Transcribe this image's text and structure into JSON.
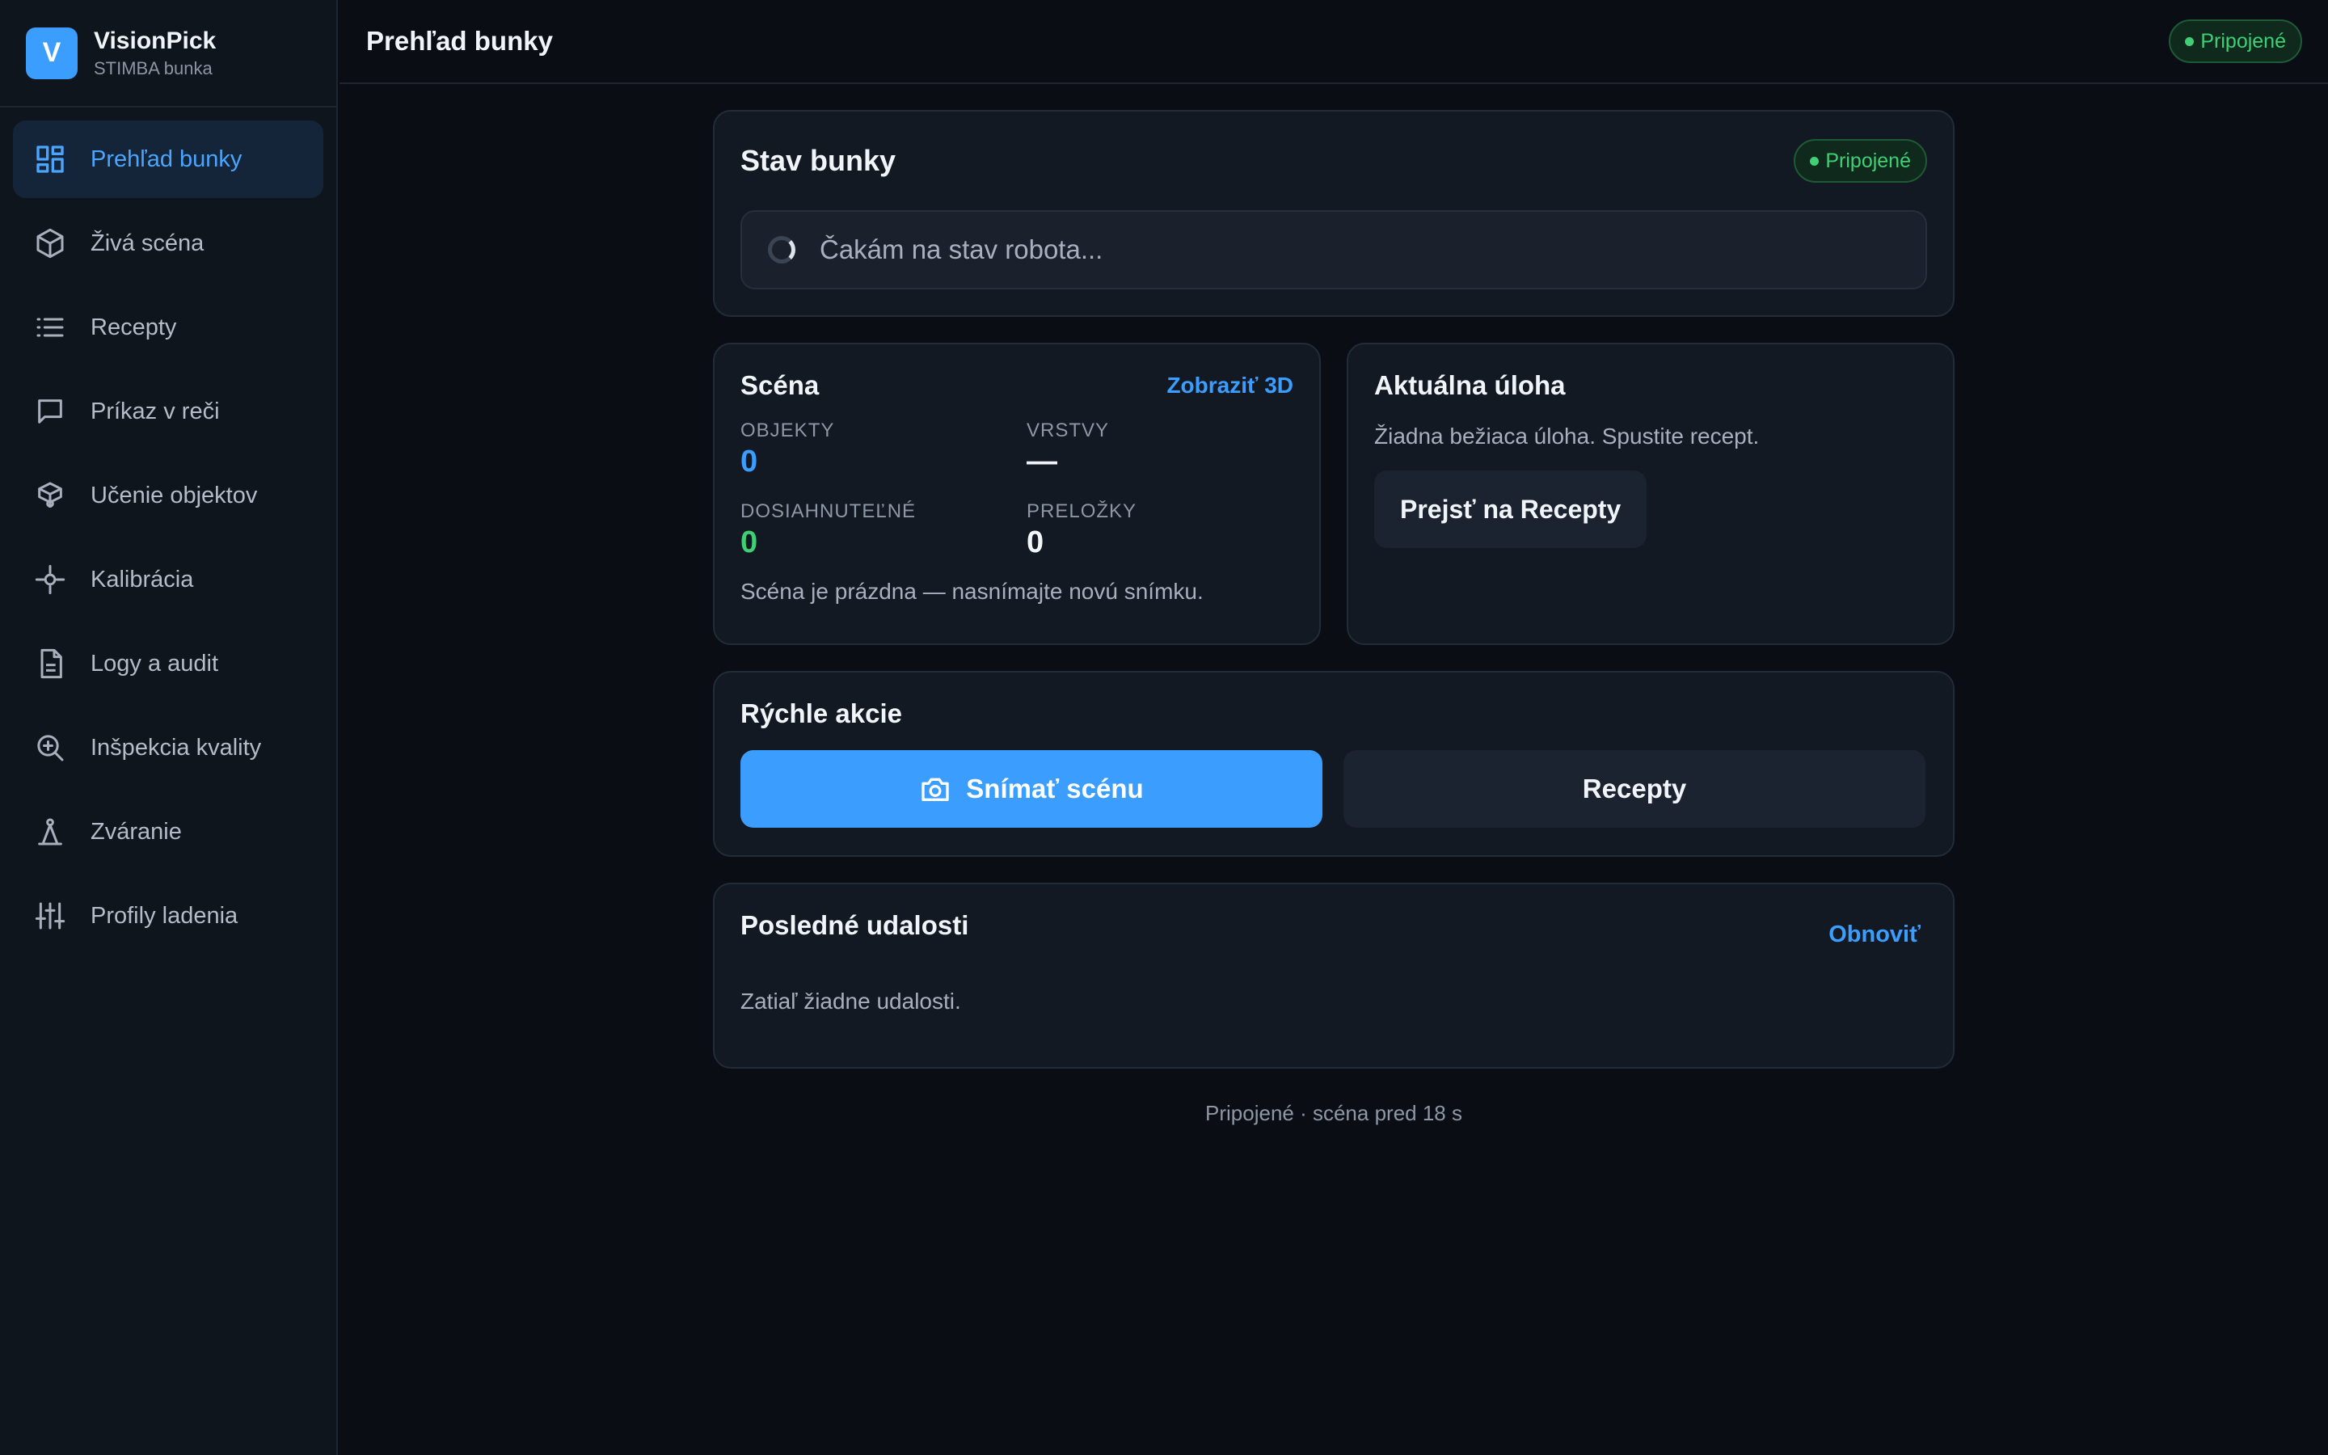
{
  "brand": {
    "logo_letter": "V",
    "name": "VisionPick",
    "subtitle": "STIMBA bunka"
  },
  "sidebar": {
    "items": [
      {
        "label": "Prehľad bunky",
        "icon": "dashboard-icon",
        "active": true
      },
      {
        "label": "Živá scéna",
        "icon": "cube-icon"
      },
      {
        "label": "Recepty",
        "icon": "list-icon"
      },
      {
        "label": "Príkaz v reči",
        "icon": "chat-icon"
      },
      {
        "label": "Učenie objektov",
        "icon": "box-learn-icon"
      },
      {
        "label": "Kalibrácia",
        "icon": "crosshair-icon"
      },
      {
        "label": "Logy a audit",
        "icon": "document-icon"
      },
      {
        "label": "Inšpekcia kvality",
        "icon": "zoom-in-icon"
      },
      {
        "label": "Zváranie",
        "icon": "welding-icon"
      },
      {
        "label": "Profily ladenia",
        "icon": "sliders-icon"
      }
    ]
  },
  "header": {
    "title": "Prehľad bunky",
    "status": "Pripojené"
  },
  "status_card": {
    "title": "Stav bunky",
    "badge": "Pripojené",
    "waiting": "Čakám na stav robota..."
  },
  "scene_card": {
    "title": "Scéna",
    "link": "Zobraziť 3D",
    "stats": {
      "objects_label": "OBJEKTY",
      "objects_value": "0",
      "layers_label": "VRSTVY",
      "layers_value": "—",
      "reachable_label": "DOSIAHNUTEĽNÉ",
      "reachable_value": "0",
      "layovers_label": "PRELOŽKY",
      "layovers_value": "0"
    },
    "note": "Scéna je prázdna — nasnímajte novú snímku."
  },
  "task_card": {
    "title": "Aktuálna úloha",
    "desc": "Žiadna bežiaca úloha. Spustite recept.",
    "button": "Prejsť na Recepty"
  },
  "actions_card": {
    "title": "Rýchle akcie",
    "primary": "Snímať scénu",
    "secondary": "Recepty"
  },
  "events_card": {
    "title": "Posledné udalosti",
    "refresh": "Obnoviť",
    "empty": "Zatiaľ žiadne udalosti."
  },
  "footer": {
    "status": "Pripojené · scéna pred 18 s"
  },
  "colors": {
    "accent": "#3b9eff",
    "success": "#3fcf75",
    "background": "#0a0e14",
    "card": "#121922"
  }
}
